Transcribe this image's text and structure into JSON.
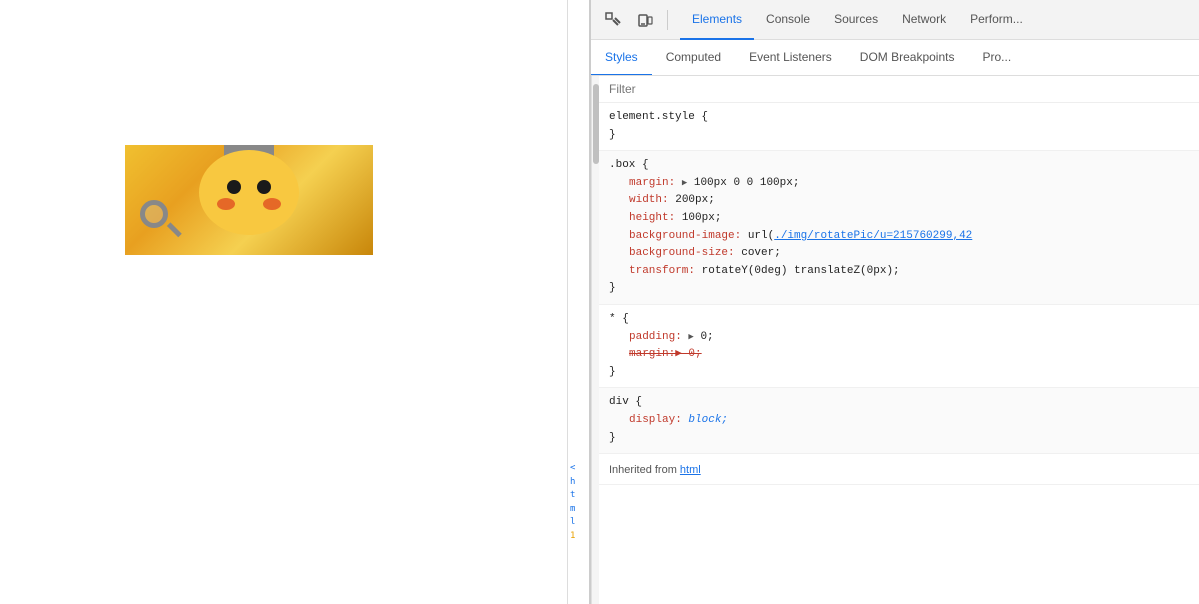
{
  "devtools": {
    "main_tabs": [
      {
        "label": "Elements",
        "active": true
      },
      {
        "label": "Console",
        "active": false
      },
      {
        "label": "Sources",
        "active": false
      },
      {
        "label": "Network",
        "active": false
      },
      {
        "label": "Perform...",
        "active": false
      }
    ],
    "sub_tabs": [
      {
        "label": "Styles",
        "active": true
      },
      {
        "label": "Computed",
        "active": false
      },
      {
        "label": "Event Listeners",
        "active": false
      },
      {
        "label": "DOM Breakpoints",
        "active": false
      },
      {
        "label": "Pro...",
        "active": false
      }
    ],
    "filter_placeholder": "Filter",
    "css_rules": [
      {
        "id": "element_style",
        "selector": "element.style {",
        "close": "}",
        "properties": []
      },
      {
        "id": "box_rule",
        "selector": ".box {",
        "close": "}",
        "properties": [
          {
            "name": "margin:",
            "indicator": "▶",
            "value": " 100px 0 0 100px;",
            "type": "normal"
          },
          {
            "name": "width:",
            "value": " 200px;",
            "type": "normal"
          },
          {
            "name": "height:",
            "value": " 100px;",
            "type": "normal"
          },
          {
            "name": "background-image:",
            "value": " url(./img/rotatePic/u=215760299,42",
            "type": "link"
          },
          {
            "name": "background-size:",
            "value": " cover;",
            "type": "normal"
          },
          {
            "name": "transform:",
            "value": " rotateY(0deg) translateZ(0px);",
            "type": "normal"
          }
        ]
      },
      {
        "id": "universal_rule",
        "selector": "* {",
        "close": "}",
        "properties": [
          {
            "name": "padding:",
            "indicator": "▶",
            "value": " 0;",
            "type": "normal"
          },
          {
            "name": "margin:▶ 0;",
            "value": "",
            "type": "strikethrough"
          }
        ]
      },
      {
        "id": "div_rule",
        "selector": "div {",
        "close": "}",
        "properties": [
          {
            "name": "display:",
            "value": " block;",
            "type": "italic"
          }
        ]
      },
      {
        "id": "inherited",
        "label": "Inherited from ",
        "link": "html"
      }
    ]
  },
  "icons": {
    "inspect": "⊡",
    "device": "▭"
  }
}
